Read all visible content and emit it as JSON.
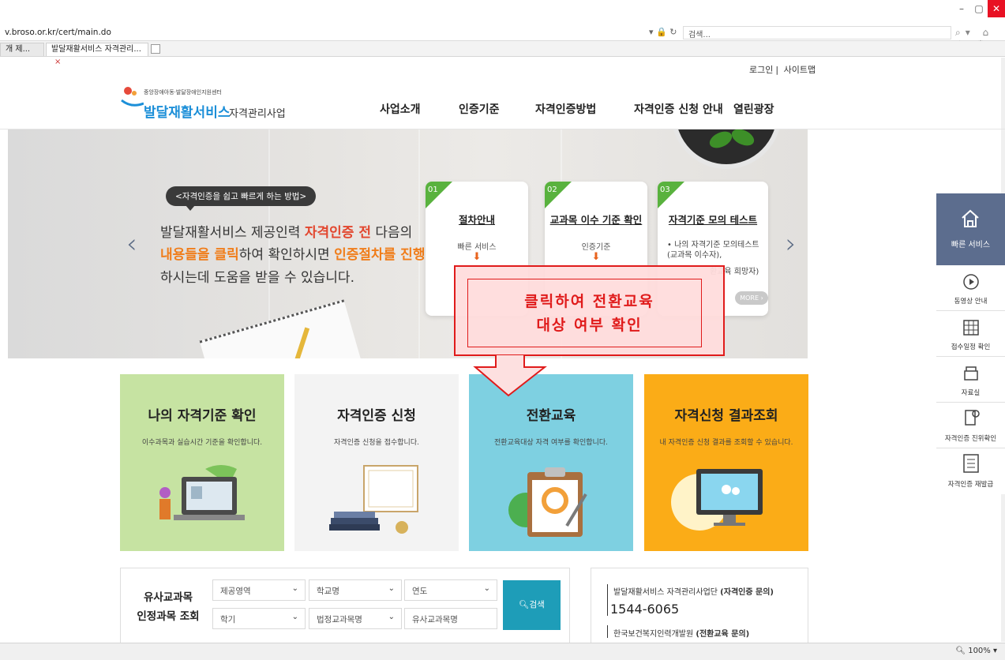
{
  "browser": {
    "url": "v.broso.or.kr/cert/main.do",
    "search_placeholder": "검색...",
    "tabs": [
      "개 제...",
      "발달재활서비스 자격관리..."
    ],
    "zoom": "100%"
  },
  "header": {
    "utility_links": [
      "로그인",
      "사이트맵"
    ],
    "logo_small": "중앙장애아동·발달장애인지원센터",
    "logo_main": "발달재활서비스",
    "logo_sub": "자격관리사업",
    "nav": [
      "사업소개",
      "인증기준",
      "자격인증방법",
      "자격인증 신청 안내",
      "열린광장"
    ]
  },
  "hero": {
    "pill": "<자격인증을 쉽고 빠르게 하는 방법>",
    "line1_a": "발달재활서비스 제공인력 ",
    "line1_b": "자격인증 전",
    "line1_c": " 다음의",
    "line2_a": "내용들을 클릭",
    "line2_b": "하여 확인하시면 ",
    "line2_c": "인증절차를 진행",
    "line3": "하시는데 도움을 받을 수 있습니다.",
    "steps": [
      {
        "num": "01",
        "title": "절차안내",
        "desc": "빠른 서비스"
      },
      {
        "num": "02",
        "title": "교과목 이수 기준 확인",
        "desc": "인증기준"
      },
      {
        "num": "03",
        "title": "자격기준 모의 테스트",
        "bullet1": "• 나의 자격기준 모의테스트",
        "bullet2": "(교과목 이수자),",
        "bullet3": "환교육 희망자)",
        "more": "MORE ›"
      }
    ]
  },
  "callout": {
    "line1": "클릭하여 전환교육",
    "line2": "대상 여부 확인"
  },
  "tiles": [
    {
      "title": "나의 자격기준 확인",
      "desc": "이수과목과 실습시간 기준을 확인합니다.",
      "color": "#c6e3a2"
    },
    {
      "title": "자격인증 신청",
      "desc": "자격인증 신청을 접수합니다.",
      "color": "#f3f3f3"
    },
    {
      "title": "전환교육",
      "desc": "전환교육대상 자격 여부를 확인합니다.",
      "color": "#7ed0e1"
    },
    {
      "title": "자격신청 결과조회",
      "desc": "내 자격인증 신청 결과를 조회할 수 있습니다.",
      "color": "#fbac17"
    }
  ],
  "search": {
    "title1": "유사교과목",
    "title2": "인정과목 조회",
    "selects": [
      "제공영역",
      "학교명",
      "연도",
      "학기",
      "법정교과목명"
    ],
    "input_placeholder": "유사교과목명",
    "button": "검색"
  },
  "contact": {
    "line1_a": "발달재활서비스 자격관리사업단 ",
    "line1_b": "(자격인증 문의)",
    "phone": "1544-6065",
    "line2_a": "한국보건복지인력개발원 ",
    "line2_b": "(전환교육 문의)"
  },
  "quick_menu": {
    "head": "빠른 서비스",
    "items": [
      "동영상 안내",
      "접수일정 확인",
      "자료실",
      "자격인증 진위확인",
      "자격인증 재발급"
    ]
  },
  "colors": {
    "accent_red": "#e01b1b",
    "brand_blue": "#1c8fd8",
    "quick_menu": "#5c6d8e",
    "search_button": "#1e9db8"
  }
}
